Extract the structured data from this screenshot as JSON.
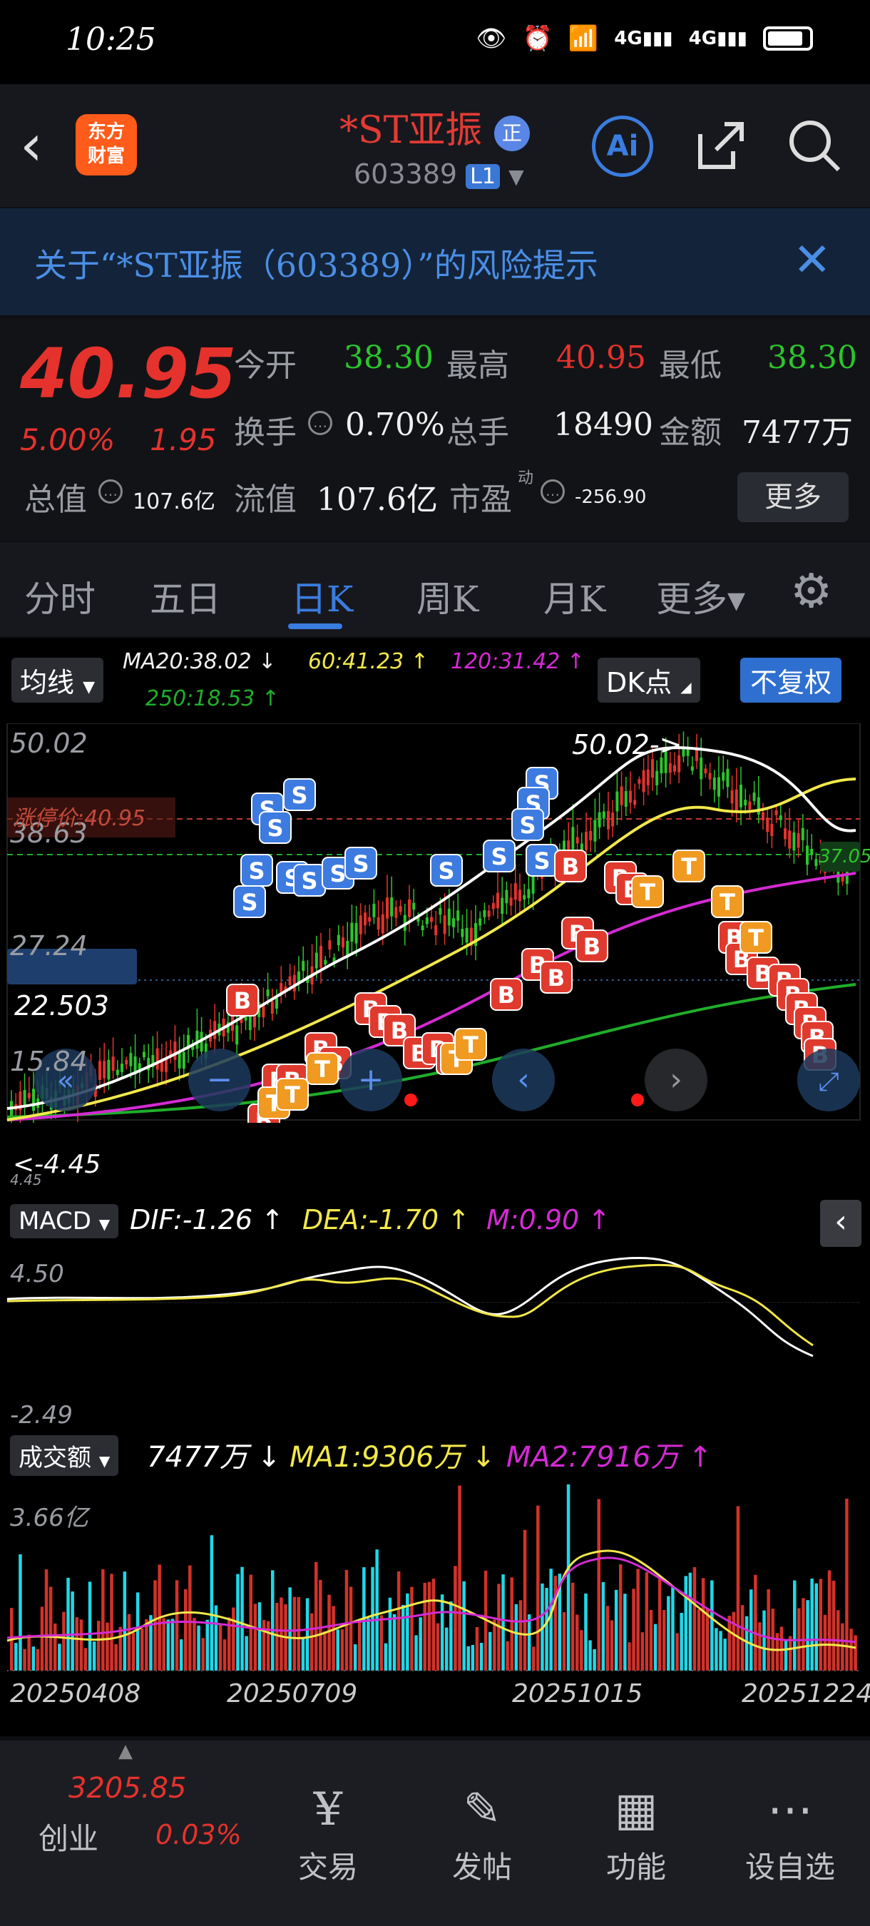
{
  "status": {
    "time": "10:25",
    "icons": [
      "eye-icon",
      "alarm-icon",
      "wifi-icon",
      "4g-signal-icon",
      "4g-signal-icon",
      "battery-icon"
    ],
    "net1": "4G",
    "net2": "4G"
  },
  "header": {
    "logo_line1": "东方",
    "logo_line2": "财富",
    "stock_name": "*ST亚振",
    "badge": "正",
    "code": "603389",
    "level": "L1",
    "ai_label": "Ai"
  },
  "banner": {
    "text": "关于“*ST亚振（603389）”的风险提示"
  },
  "quote": {
    "price": "40.95",
    "change_pct": "5.00%",
    "change": "1.95",
    "open_label": "今开",
    "open": "38.30",
    "high_label": "最高",
    "high": "40.95",
    "low_label": "最低",
    "low": "38.30",
    "turnover_label": "换手",
    "turnover": "0.70%",
    "volume_label": "总手",
    "volume": "18490",
    "amount_label": "金额",
    "amount": "7477万",
    "mktcap_label": "总值",
    "mktcap": "107.6亿",
    "float_label": "流值",
    "float": "107.6亿",
    "pe_label": "市盈",
    "pe_sup": "动",
    "pe": "-256.90",
    "more_label": "更多"
  },
  "tabs": [
    {
      "label": "分时"
    },
    {
      "label": "五日"
    },
    {
      "label": "日K"
    },
    {
      "label": "周K"
    },
    {
      "label": "月K"
    },
    {
      "label": "更多▾"
    }
  ],
  "chart_controls": {
    "ma_button": "均线",
    "dk_button": "DK点",
    "fq_button": "不复权",
    "ma20": "MA20:38.02 ↓",
    "ma60": "60:41.23 ↑",
    "ma120": "120:31.42 ↑",
    "ma250": "250:18.53 ↑"
  },
  "colors": {
    "up": "#e5322d",
    "down": "#2cc52c",
    "accent": "#3a7de0",
    "ma20": "#ffffff",
    "ma60": "#f2e84a",
    "ma120": "#d42ad4",
    "ma250": "#1fae2a"
  },
  "kchart": {
    "y_top": "50.02",
    "y2": "38.63",
    "y3": "27.24",
    "y4": "22.503",
    "y5": "15.84",
    "y6": "4.45",
    "limit_label": "涨停价:40.95",
    "high_mark": "50.02->",
    "low_mark": "<-4.45",
    "ref_label": "37.05"
  },
  "macd": {
    "button": "MACD",
    "dif": "DIF:-1.26 ↑",
    "dea": "DEA:-1.70 ↑",
    "m": "M:0.90 ↑",
    "y_top": "4.50",
    "y_bot": "-2.49"
  },
  "volume": {
    "button": "成交额",
    "value": "7477万 ↓",
    "ma1": "MA1:9306万 ↓",
    "ma2": "MA2:7916万 ↑",
    "y_top": "3.66亿"
  },
  "dates": [
    "20250408",
    "20250709",
    "20251015",
    "20251224"
  ],
  "bottom": {
    "index_value": "3205.85",
    "index_name": "创业",
    "index_change": "0.03%",
    "items": [
      {
        "label": "交易"
      },
      {
        "label": "发帖"
      },
      {
        "label": "功能"
      },
      {
        "label": "设自选"
      }
    ]
  }
}
